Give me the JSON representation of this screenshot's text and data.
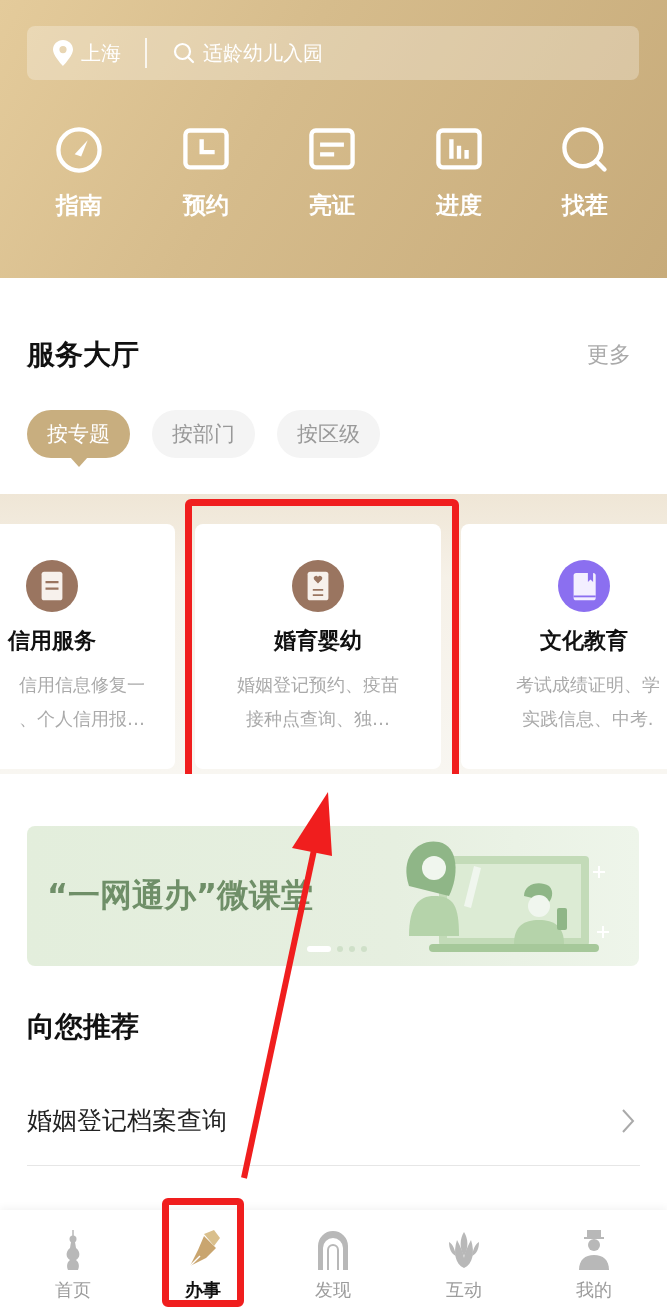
{
  "header": {
    "location": "上海",
    "search": {
      "placeholder": "适龄幼儿入园"
    },
    "shortcuts": [
      {
        "kind": "gauge",
        "label": "指南"
      },
      {
        "kind": "calendar",
        "label": "预约"
      },
      {
        "kind": "card",
        "label": "亮证"
      },
      {
        "kind": "chart",
        "label": "进度"
      },
      {
        "kind": "search",
        "label": "找茬"
      }
    ]
  },
  "service_hall": {
    "title": "服务大厅",
    "more": "更多",
    "filters": [
      {
        "label": "按专题",
        "selected": true
      },
      {
        "label": "按部门",
        "selected": false
      },
      {
        "label": "按区级",
        "selected": false
      }
    ],
    "cards": [
      {
        "kind": "cut-left",
        "color": "#9a7560",
        "title": "信用服务",
        "lines": [
          "信用信息修复一",
          "、个人信用报…"
        ],
        "highlighted": false
      },
      {
        "kind": "full",
        "color": "#9a7560",
        "title": "婚育婴幼",
        "lines": [
          "婚姻登记预约、疫苗",
          "接种点查询、独…"
        ],
        "highlighted": true
      },
      {
        "kind": "cut-right",
        "color": "#8b6ff0",
        "title": "文化教育",
        "lines": [
          "考试成绩证明、学",
          "实践信息、中考."
        ],
        "highlighted": false
      }
    ]
  },
  "banner": {
    "title": "“一网通办”微课堂",
    "dots": [
      {
        "selected": true
      },
      {
        "selected": false
      },
      {
        "selected": false
      },
      {
        "selected": false
      }
    ]
  },
  "recommend": {
    "title": "向您推荐",
    "items": [
      {
        "label": "婚姻登记档案查询"
      }
    ]
  },
  "tab_bar": [
    {
      "kind": "tower",
      "label": "首页",
      "selected": false,
      "highlighted": false
    },
    {
      "kind": "pen",
      "label": "办事",
      "selected": true,
      "highlighted": true
    },
    {
      "kind": "arch",
      "label": "发现",
      "selected": false,
      "highlighted": false
    },
    {
      "kind": "flower",
      "label": "互动",
      "selected": false,
      "highlighted": false
    },
    {
      "kind": "person",
      "label": "我的",
      "selected": false,
      "highlighted": false
    }
  ]
}
